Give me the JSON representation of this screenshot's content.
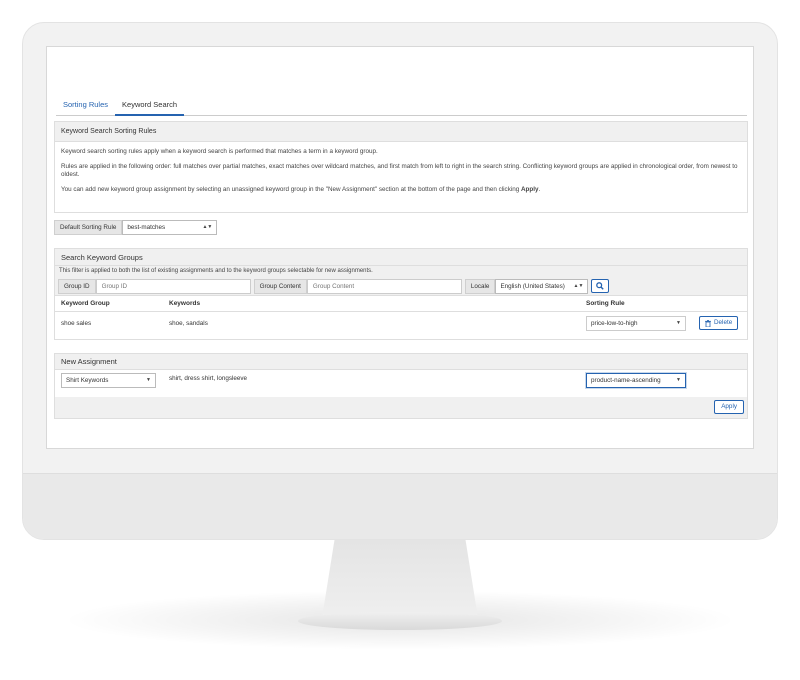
{
  "tabs": [
    {
      "label": "Sorting Rules"
    },
    {
      "label": "Keyword Search"
    }
  ],
  "info": {
    "title": "Keyword Search Sorting Rules",
    "para1": "Keyword search sorting rules apply when a keyword search is performed that matches a term in a keyword group.",
    "para2": "Rules are applied in the following order: full matches over partial matches, exact matches over wildcard matches, and first match from left to right in the search string. Conflicting keyword groups are applied in chronological order, from newest to oldest.",
    "para3_prefix": "You can add new keyword group assignment by selecting an unassigned keyword group in the \"New Assignment\" section at the bottom of the page and then clicking ",
    "para3_bold": "Apply",
    "para3_suffix": "."
  },
  "default_rule": {
    "label": "Default Sorting Rule",
    "value": "best-matches"
  },
  "search": {
    "title": "Search Keyword Groups",
    "note": "This filter is applied to both the list of existing assignments and to the keyword groups selectable for new assignments.",
    "group_id_label": "Group ID",
    "group_id_placeholder": "Group ID",
    "group_content_label": "Group Content",
    "group_content_placeholder": "Group Content",
    "locale_label": "Locale",
    "locale_value": "English (United States)"
  },
  "table": {
    "headers": {
      "group": "Keyword Group",
      "keywords": "Keywords",
      "rule": "Sorting Rule"
    },
    "rows": [
      {
        "group": "shoe sales",
        "keywords": "shoe, sandals",
        "rule": "price-low-to-high",
        "action": "Delete"
      }
    ]
  },
  "assignment": {
    "title": "New Assignment",
    "group": "Shirt Keywords",
    "keywords": "shirt, dress shirt, longsleeve",
    "rule": "product-name-ascending",
    "apply_label": "Apply"
  },
  "colors": {
    "accent": "#2563b0",
    "panel_bg": "#f0f0f0"
  }
}
